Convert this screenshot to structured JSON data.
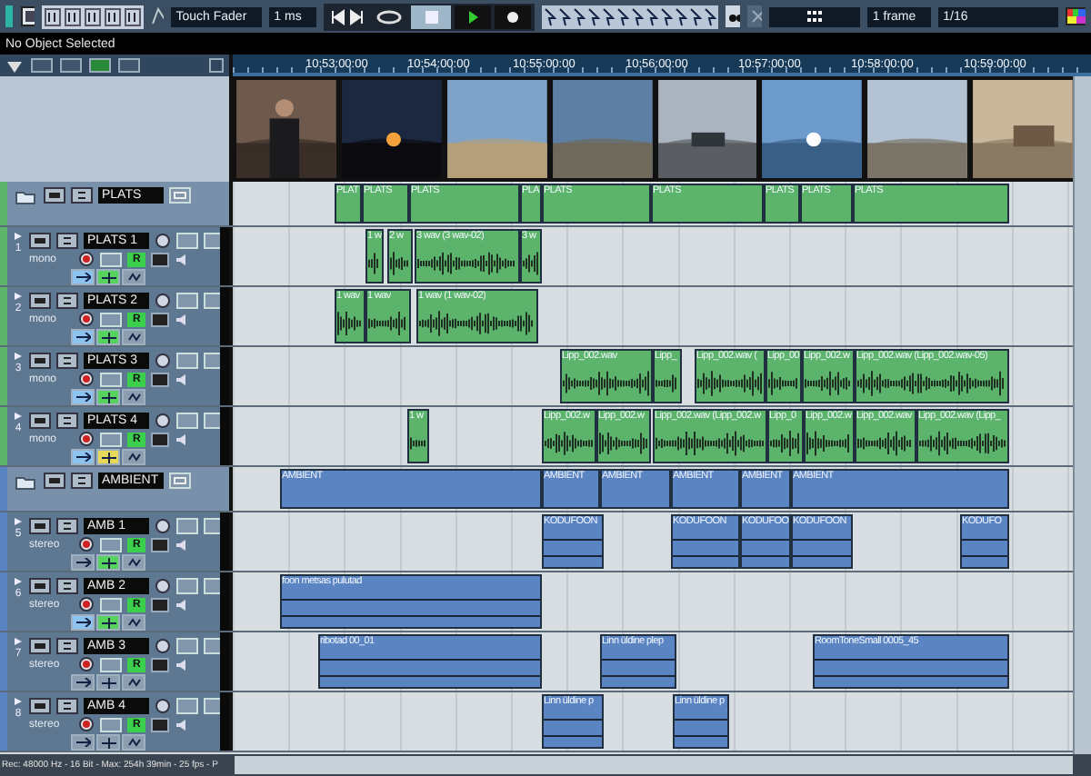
{
  "toolbar": {
    "automation_mode": "Touch Fader",
    "preroll": "1 ms",
    "grid_type": "1 frame",
    "quantize": "1/16"
  },
  "info_line": "No Object Selected",
  "ruler": {
    "marks": [
      "10:53:00:00",
      "10:54:00:00",
      "10:55:00:00",
      "10:56:00:00",
      "10:57:00:00",
      "10:58:00:00",
      "10:59:00:00"
    ]
  },
  "tracks": [
    {
      "kind": "folder",
      "name": "PLATS",
      "color": "#5cb46c",
      "events": [
        {
          "label": "PLAT"
        },
        {
          "label": "PLATS"
        },
        {
          "label": "PLATS"
        },
        {
          "label": "PLA"
        },
        {
          "label": "PLATS"
        },
        {
          "label": "PLATS"
        },
        {
          "label": "PLATS"
        },
        {
          "label": "PLATS"
        },
        {
          "label": "PLATS"
        }
      ]
    },
    {
      "kind": "audio",
      "number": "1",
      "name": "PLATS 1",
      "channels": "mono",
      "read": "R",
      "edit_on": true,
      "insert_on": true,
      "insert_bypassed": false,
      "color": "#5cb46c",
      "events": [
        {
          "label": "1 w"
        },
        {
          "label": "2 w"
        },
        {
          "label": "3 wav (3 wav-02)"
        },
        {
          "label": "3 w"
        }
      ]
    },
    {
      "kind": "audio",
      "number": "2",
      "name": "PLATS 2",
      "channels": "mono",
      "read": "R",
      "edit_on": true,
      "insert_on": true,
      "insert_bypassed": false,
      "color": "#5cb46c",
      "events": [
        {
          "label": "1 wav"
        },
        {
          "label": "1 wav"
        },
        {
          "label": "1 wav (1 wav-02)"
        }
      ]
    },
    {
      "kind": "audio",
      "number": "3",
      "name": "PLATS 3",
      "channels": "mono",
      "read": "R",
      "edit_on": true,
      "insert_on": true,
      "insert_bypassed": false,
      "color": "#5cb46c",
      "events": [
        {
          "label": "Lipp_002.wav"
        },
        {
          "label": "Lipp_"
        },
        {
          "label": "Lipp_002.wav ("
        },
        {
          "label": "Lipp_00"
        },
        {
          "label": "Lipp_002.w"
        },
        {
          "label": "Lipp_002.wav (Lipp_002.wav-05)"
        }
      ]
    },
    {
      "kind": "audio",
      "number": "4",
      "name": "PLATS 4",
      "channels": "mono",
      "read": "R",
      "edit_on": true,
      "insert_on": true,
      "insert_bypassed": true,
      "color": "#5cb46c",
      "events": [
        {
          "label": "1 w"
        },
        {
          "label": "Lipp_002.w"
        },
        {
          "label": "Lipp_002.w"
        },
        {
          "label": "Lipp_002.wav (Lipp_002.w"
        },
        {
          "label": "Lipp_0"
        },
        {
          "label": "Lipp_002.w"
        },
        {
          "label": "Lipp_002.wav"
        },
        {
          "label": "Lipp_002.wav (Lipp_"
        }
      ]
    },
    {
      "kind": "folder",
      "name": "AMBIENT",
      "color": "#5b84c2",
      "events": [
        {
          "label": "AMBIENT"
        },
        {
          "label": "AMBIENT"
        },
        {
          "label": "AMBIENT"
        },
        {
          "label": "AMBIENT"
        },
        {
          "label": "AMBIENT"
        },
        {
          "label": "AMBIENT"
        }
      ]
    },
    {
      "kind": "audio",
      "number": "5",
      "name": "AMB 1",
      "channels": "stereo",
      "read": "R",
      "edit_on": false,
      "insert_on": true,
      "insert_bypassed": false,
      "color": "#5b84c2",
      "events": [
        {
          "label": "KODUFOON"
        },
        {
          "label": "KODUFOON"
        },
        {
          "label": "KODUFOO"
        },
        {
          "label": "KODUFOON"
        },
        {
          "label": "KODUFO"
        }
      ]
    },
    {
      "kind": "audio",
      "number": "6",
      "name": "AMB 2",
      "channels": "stereo",
      "read": "R",
      "edit_on": true,
      "insert_on": true,
      "insert_bypassed": false,
      "color": "#5b84c2",
      "events": [
        {
          "label": "foon metsas pulutad"
        }
      ]
    },
    {
      "kind": "audio",
      "number": "7",
      "name": "AMB 3",
      "channels": "stereo",
      "read": "R",
      "edit_on": false,
      "insert_on": false,
      "color": "#5b84c2",
      "events": [
        {
          "label": "ribotad 00_01"
        },
        {
          "label": "Linn üldine plep"
        },
        {
          "label": "RoomToneSmall 0005_45"
        }
      ]
    },
    {
      "kind": "audio",
      "number": "8",
      "name": "AMB 4",
      "channels": "stereo",
      "read": "R",
      "edit_on": false,
      "insert_on": false,
      "color": "#5b84c2",
      "events": [
        {
          "label": "Linn üldine p"
        },
        {
          "label": "Linn üldine p"
        }
      ]
    }
  ],
  "status_bar": "Rec: 48000 Hz - 16 Bit - Max: 254h 39min - 25 fps - P"
}
